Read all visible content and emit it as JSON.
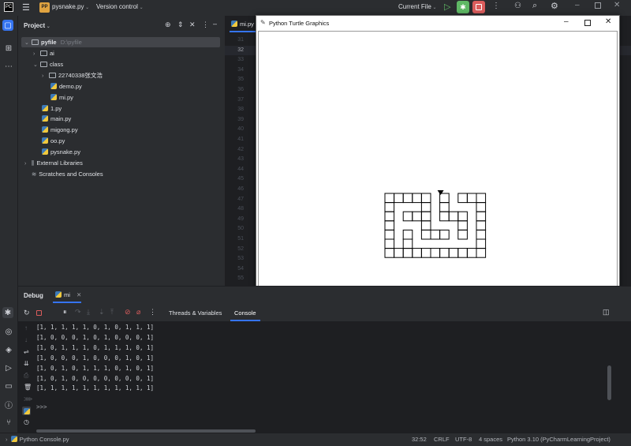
{
  "titlebar": {
    "project_badge": "PP",
    "project_name": "pysnake.py",
    "version_control": "Version control",
    "run_config": "Current File"
  },
  "project_panel": {
    "title": "Project",
    "tree": [
      {
        "label": "pyfile",
        "hint": "D:\\pyfile",
        "kind": "folder",
        "level": 0,
        "expanded": true
      },
      {
        "label": "ai",
        "kind": "folder",
        "level": 1,
        "expanded": false
      },
      {
        "label": "class",
        "kind": "folder",
        "level": 1,
        "expanded": true
      },
      {
        "label": "22740338张文浩",
        "kind": "folder",
        "level": 2,
        "expanded": false
      },
      {
        "label": "demo.py",
        "kind": "py",
        "level": 3
      },
      {
        "label": "mi.py",
        "kind": "py",
        "level": 3
      },
      {
        "label": "1.py",
        "kind": "py",
        "level": 2
      },
      {
        "label": "main.py",
        "kind": "py",
        "level": 2
      },
      {
        "label": "migong.py",
        "kind": "py",
        "level": 2
      },
      {
        "label": "oo.py",
        "kind": "py",
        "level": 2
      },
      {
        "label": "pysnake.py",
        "kind": "py",
        "level": 2
      },
      {
        "label": "External Libraries",
        "kind": "lib",
        "level": 0,
        "expanded": false
      },
      {
        "label": "Scratches and Consoles",
        "kind": "scratch",
        "level": 0
      }
    ]
  },
  "editor": {
    "tab_label": "mi.py",
    "line_numbers": [
      "31",
      "32",
      "33",
      "34",
      "35",
      "36",
      "37",
      "38",
      "39",
      "40",
      "41",
      "42",
      "43",
      "44",
      "45",
      "46",
      "47",
      "48",
      "49",
      "50",
      "51",
      "52",
      "53",
      "54",
      "55"
    ]
  },
  "turtle_window": {
    "title": "Python Turtle Graphics",
    "grid": [
      [
        1,
        1,
        1,
        1,
        1,
        0,
        1,
        0,
        1,
        1,
        1
      ],
      [
        1,
        0,
        0,
        0,
        1,
        0,
        1,
        0,
        0,
        0,
        1
      ],
      [
        1,
        0,
        1,
        1,
        1,
        0,
        1,
        1,
        1,
        0,
        1
      ],
      [
        1,
        0,
        0,
        0,
        1,
        0,
        0,
        0,
        1,
        0,
        1
      ],
      [
        1,
        0,
        1,
        0,
        1,
        1,
        1,
        0,
        1,
        0,
        1
      ],
      [
        1,
        0,
        1,
        0,
        0,
        0,
        0,
        0,
        0,
        0,
        1
      ],
      [
        1,
        1,
        1,
        1,
        1,
        1,
        1,
        1,
        1,
        1,
        1
      ]
    ]
  },
  "debug_panel": {
    "title": "Debug",
    "session_tab": "mi",
    "tabs": [
      "Threads & Variables",
      "Console"
    ],
    "active_tab": "Console",
    "console_lines": [
      "[1, 1, 1, 1, 1, 0, 1, 0, 1, 1, 1]",
      "[1, 0, 0, 0, 1, 0, 1, 0, 0, 0, 1]",
      "[1, 0, 1, 1, 1, 0, 1, 1, 1, 0, 1]",
      "[1, 0, 0, 0, 1, 0, 0, 0, 1, 0, 1]",
      "[1, 0, 1, 0, 1, 1, 1, 0, 1, 0, 1]",
      "[1, 0, 1, 0, 0, 0, 0, 0, 0, 0, 1]",
      "[1, 1, 1, 1, 1, 1, 1, 1, 1, 1, 1]"
    ],
    "prompt": ">>>"
  },
  "statusbar": {
    "left": "Python Console.py",
    "position": "32:52",
    "line_ending": "CRLF",
    "encoding": "UTF-8",
    "indent": "4 spaces",
    "interpreter": "Python 3.10 (PyCharmLearningProject)"
  },
  "colors": {
    "accent_green": "#5fb865",
    "stop_red": "#db5c5c",
    "badge_orange": "#e0a340"
  }
}
